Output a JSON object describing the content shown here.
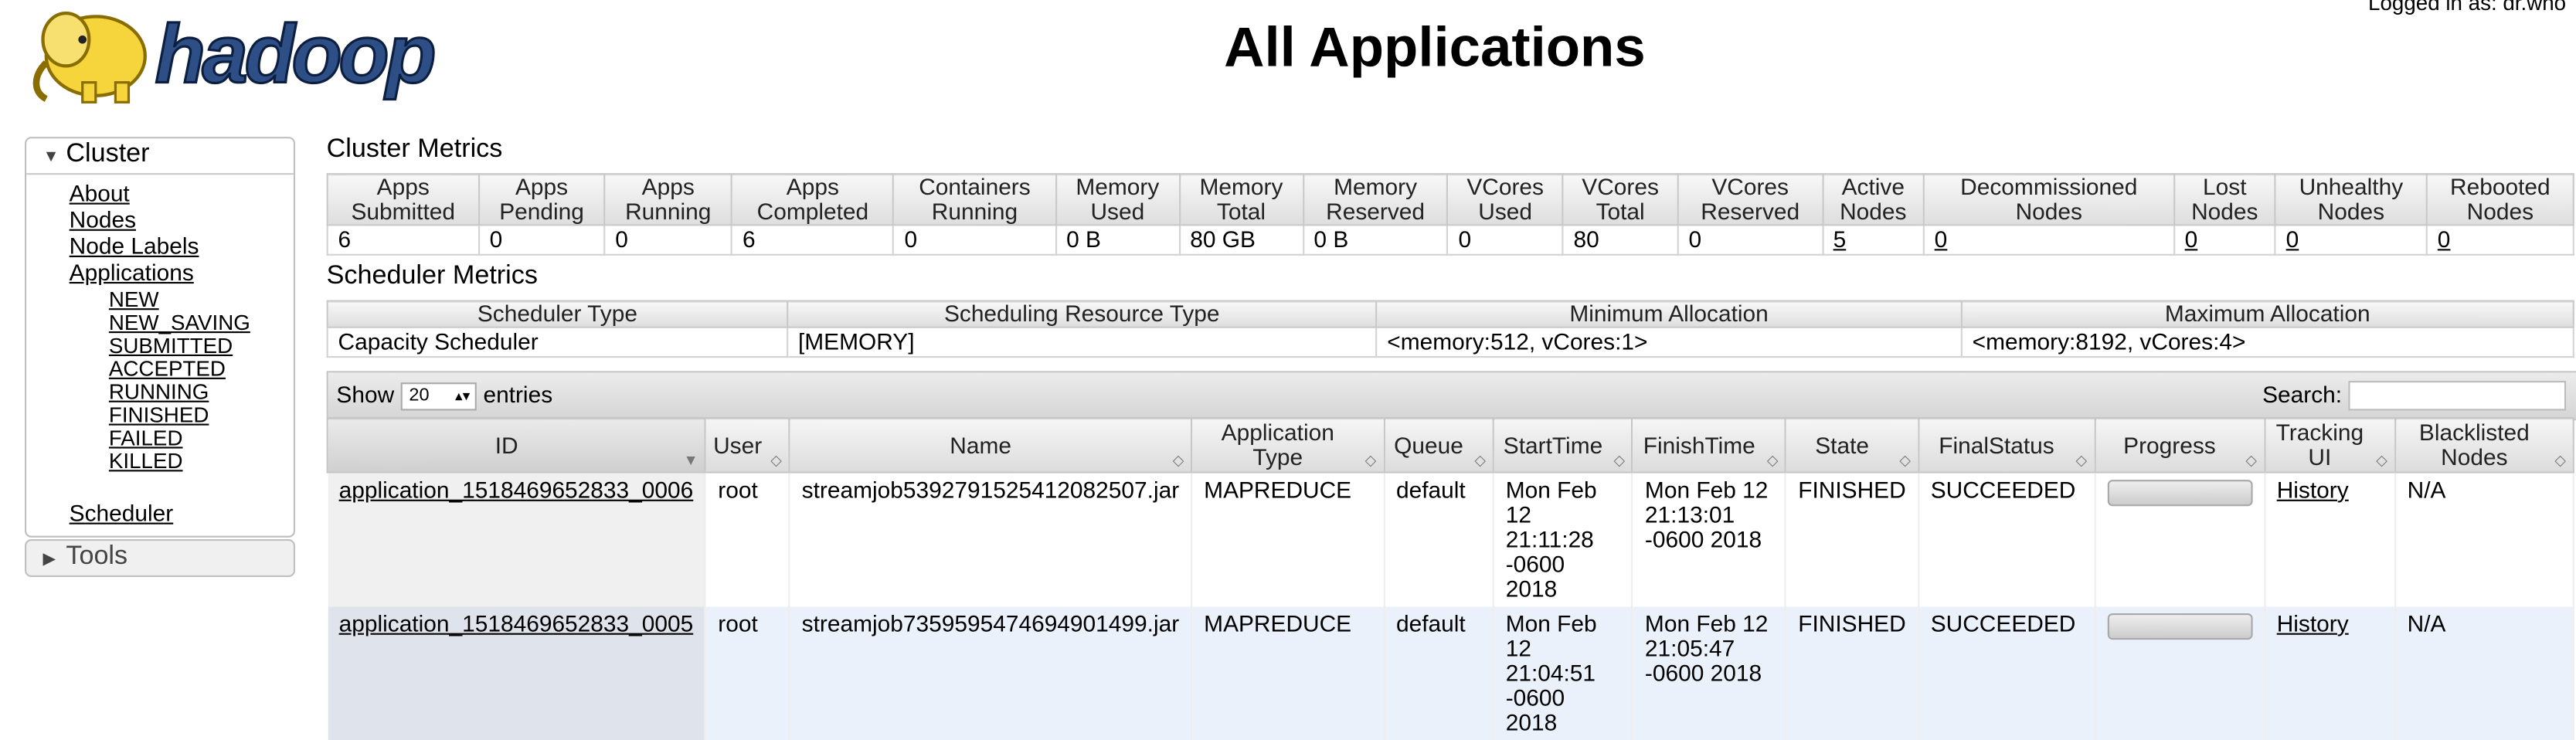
{
  "header": {
    "logo_text": "hadoop",
    "title": "All Applications",
    "login": "Logged in as: dr.who"
  },
  "sidebar": {
    "cluster": {
      "label": "Cluster",
      "items": [
        "About",
        "Nodes",
        "Node Labels",
        "Applications"
      ],
      "app_states": [
        "NEW",
        "NEW_SAVING",
        "SUBMITTED",
        "ACCEPTED",
        "RUNNING",
        "FINISHED",
        "FAILED",
        "KILLED"
      ],
      "scheduler": "Scheduler"
    },
    "tools": {
      "label": "Tools"
    }
  },
  "cluster_metrics": {
    "title": "Cluster Metrics",
    "headers": [
      [
        "Apps",
        "Submitted"
      ],
      [
        "Apps",
        "Pending"
      ],
      [
        "Apps",
        "Running"
      ],
      [
        "Apps",
        "Completed"
      ],
      [
        "Containers",
        "Running"
      ],
      [
        "Memory",
        "Used"
      ],
      [
        "Memory",
        "Total"
      ],
      [
        "Memory",
        "Reserved"
      ],
      [
        "VCores",
        "Used"
      ],
      [
        "VCores",
        "Total"
      ],
      [
        "VCores",
        "Reserved"
      ],
      [
        "Active",
        "Nodes"
      ],
      [
        "Decommissioned",
        "Nodes"
      ],
      [
        "Lost",
        "Nodes"
      ],
      [
        "Unhealthy",
        "Nodes"
      ],
      [
        "Rebooted",
        "Nodes"
      ]
    ],
    "values": [
      "6",
      "0",
      "0",
      "6",
      "0",
      "0 B",
      "80 GB",
      "0 B",
      "0",
      "80",
      "0",
      "5",
      "0",
      "0",
      "0",
      "0"
    ]
  },
  "scheduler_metrics": {
    "title": "Scheduler Metrics",
    "headers": [
      "Scheduler Type",
      "Scheduling Resource Type",
      "Minimum Allocation",
      "Maximum Allocation"
    ],
    "values": [
      "Capacity Scheduler",
      "[MEMORY]",
      "<memory:512, vCores:1>",
      "<memory:8192, vCores:4>"
    ]
  },
  "apps_table": {
    "show_label": "Show",
    "entries_value": "20",
    "entries_label": "entries",
    "search_label": "Search:",
    "columns": [
      [
        "ID"
      ],
      [
        "User"
      ],
      [
        "Name"
      ],
      [
        "Application Type"
      ],
      [
        "Queue"
      ],
      [
        "StartTime"
      ],
      [
        "FinishTime"
      ],
      [
        "State"
      ],
      [
        "FinalStatus"
      ],
      [
        "Progress"
      ],
      [
        "Tracking UI"
      ],
      [
        "Blacklisted",
        "Nodes"
      ]
    ],
    "rows": [
      {
        "id": "application_1518469652833_0006",
        "user": "root",
        "name": "streamjob5392791525412082507.jar",
        "type": "MAPREDUCE",
        "queue": "default",
        "start": [
          "Mon Feb 12",
          "21:11:28",
          "-0600 2018"
        ],
        "finish": [
          "Mon Feb 12",
          "21:13:01",
          "-0600 2018"
        ],
        "state": "FINISHED",
        "final_status": "SUCCEEDED",
        "progress": 0,
        "tracking": "History",
        "blacklisted": "N/A"
      },
      {
        "id": "application_1518469652833_0005",
        "user": "root",
        "name": "streamjob7359595474694901499.jar",
        "type": "MAPREDUCE",
        "queue": "default",
        "start": [
          "Mon Feb 12",
          "21:04:51",
          "-0600 2018"
        ],
        "finish": [
          "Mon Feb 12",
          "21:05:47",
          "-0600 2018"
        ],
        "state": "FINISHED",
        "final_status": "SUCCEEDED",
        "progress": 0,
        "tracking": "History",
        "blacklisted": "N/A"
      }
    ]
  },
  "colors": {
    "logo_yellow": "#f5d53b",
    "logo_text": "#2d4f86",
    "row_alt": "#eaf1fb"
  }
}
